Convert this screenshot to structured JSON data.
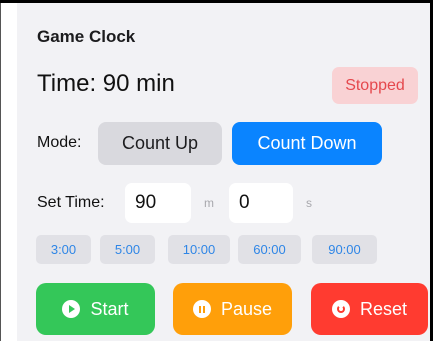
{
  "title": "Game Clock",
  "time_display": "Time: 90 min",
  "status": "Stopped",
  "mode": {
    "label": "Mode:",
    "options": [
      "Count Up",
      "Count Down"
    ],
    "selected": "Count Down"
  },
  "set_time": {
    "label": "Set Time:",
    "minutes_value": "90",
    "minutes_unit": "m",
    "seconds_value": "0",
    "seconds_unit": "s"
  },
  "presets": [
    "3:00",
    "5:00",
    "10:00",
    "60:00",
    "90:00"
  ],
  "actions": {
    "start": "Start",
    "pause": "Pause",
    "reset": "Reset"
  },
  "colors": {
    "accent": "#0a84ff",
    "status_bg": "#f9d2d4",
    "status_text": "#e5484d",
    "start": "#34c759",
    "pause": "#ff9f0a",
    "reset": "#ff3b30"
  },
  "icons": {
    "start": "play-icon",
    "pause": "pause-icon",
    "reset": "reset-icon"
  }
}
